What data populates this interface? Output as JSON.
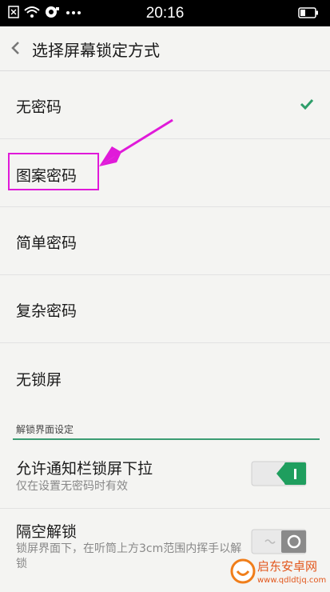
{
  "status": {
    "time": "20:16"
  },
  "header": {
    "title": "选择屏幕锁定方式"
  },
  "lock_options": [
    {
      "label": "无密码",
      "selected": true
    },
    {
      "label": "图案密码",
      "selected": false
    },
    {
      "label": "简单密码",
      "selected": false
    },
    {
      "label": "复杂密码",
      "selected": false
    },
    {
      "label": "无锁屏",
      "selected": false
    }
  ],
  "section": {
    "title": "解锁界面设定"
  },
  "settings": [
    {
      "name": "允许通知栏锁屏下拉",
      "desc": "仅在设置无密码时有效",
      "enabled": true
    },
    {
      "name": "隔空解锁",
      "desc": "锁屏界面下，在听筒上方3cm范围内挥手以解锁",
      "enabled": false
    }
  ],
  "watermark": {
    "name": "启东安卓网",
    "url": "www.qdldtjq.com"
  },
  "colors": {
    "accent": "#2e9e6a",
    "highlight": "#e01ad9",
    "toggle_on": "#1f9e5e"
  }
}
